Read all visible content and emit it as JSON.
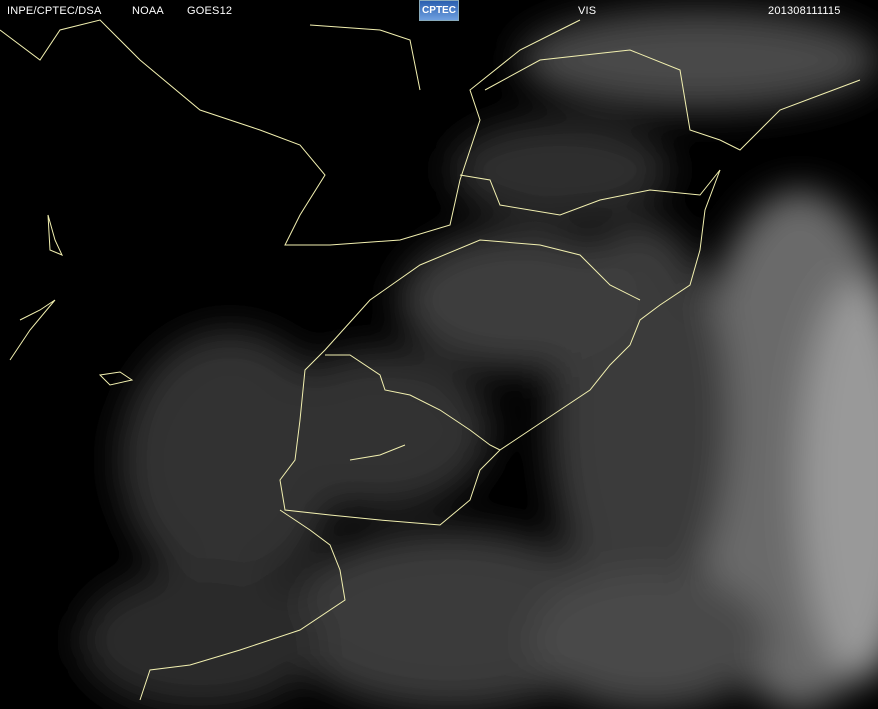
{
  "header": {
    "agency": "INPE/CPTEC/DSA",
    "source": "NOAA",
    "satellite": "GOES12",
    "logo_text": "CPTEC",
    "channel": "VIS",
    "timestamp": "201308111115"
  },
  "colors": {
    "borders": "#f2f0b0",
    "background": "#000000",
    "clouds": "#8a8a8a"
  }
}
